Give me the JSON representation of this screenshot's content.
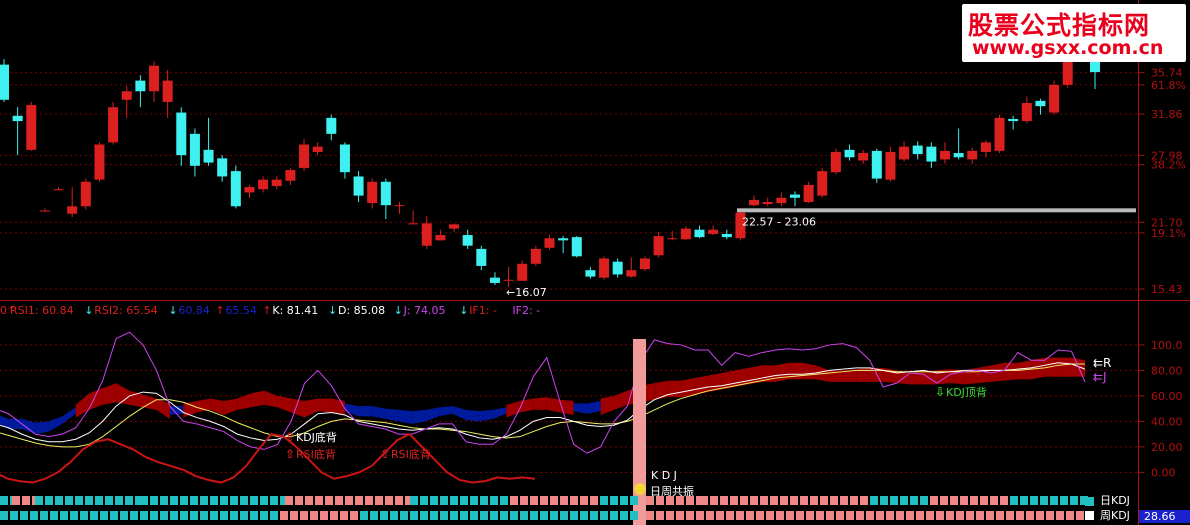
{
  "watermark": {
    "line1": "股票公式指标网",
    "line2": "www.gsxx.com.cn"
  },
  "colors": {
    "bg": "#000000",
    "up": "#dc1f1f",
    "down": "#3ff0f0",
    "grid": "#7a0000",
    "axis": "#b01010",
    "white": "#ffffff",
    "magenta": "#cc44ee",
    "yellow": "#f0f060",
    "blue_fill": "#001a9e",
    "red_fill": "#9e0000",
    "green": "#33dd33",
    "pink": "#f08888",
    "cyan_block": "#22bfc2"
  },
  "price_axis": {
    "labels": [
      {
        "text": "35.74",
        "y": 35.74
      },
      {
        "text": "61.8%",
        "y": 34.6
      },
      {
        "text": "31.86",
        "y": 31.86
      },
      {
        "text": "27.98",
        "y": 27.98
      },
      {
        "text": "38.2%",
        "y": 27.1
      },
      {
        "text": "21.70",
        "y": 21.7
      },
      {
        "text": "19.1%",
        "y": 20.7
      },
      {
        "text": "15.43",
        "y": 15.43
      }
    ],
    "ylim": [
      14.4,
      39.0
    ]
  },
  "candles": [
    [
      36.5,
      33.2,
      37,
      33
    ],
    [
      31.7,
      31.2,
      32.5,
      28
    ],
    [
      28.5,
      32.7,
      33,
      28.4
    ],
    [
      22.8,
      22.8,
      23,
      22.7
    ],
    [
      24.8,
      24.8,
      25,
      24.7
    ],
    [
      22.5,
      23.2,
      25,
      22.2
    ],
    [
      23.2,
      25.5,
      25.8,
      22.9
    ],
    [
      25.7,
      29,
      29.2,
      25.5
    ],
    [
      29.2,
      32.5,
      33,
      29
    ],
    [
      33.2,
      34,
      34.5,
      31.5
    ],
    [
      35,
      34,
      35.5,
      32.5
    ],
    [
      34,
      36.4,
      36.8,
      33
    ],
    [
      33,
      35,
      36,
      31.5
    ],
    [
      32,
      28,
      32.5,
      27
    ],
    [
      30,
      27,
      30.5,
      26
    ],
    [
      28.5,
      27.3,
      31.5,
      27
    ],
    [
      27.7,
      26,
      28,
      25.5
    ],
    [
      26.5,
      23.2,
      27,
      23
    ],
    [
      24.5,
      25,
      25.2,
      24
    ],
    [
      24.8,
      25.7,
      26,
      24.5
    ],
    [
      25.1,
      25.7,
      26,
      24.8
    ],
    [
      25.6,
      26.6,
      26.8,
      25.2
    ],
    [
      26.8,
      29,
      29.5,
      26.5
    ],
    [
      28.3,
      28.8,
      29.2,
      28
    ],
    [
      31.5,
      30,
      31.8,
      29.4
    ],
    [
      29,
      26.4,
      29.2,
      25.8
    ],
    [
      26,
      24.2,
      26.5,
      23.6
    ],
    [
      23.5,
      25.5,
      25.8,
      23
    ],
    [
      25.5,
      23.3,
      25.8,
      22
    ],
    [
      23.3,
      23.3,
      23.6,
      22.5
    ],
    [
      21.6,
      21.6,
      22.8,
      21.5
    ],
    [
      19.5,
      21.6,
      22.3,
      19.2
    ],
    [
      20,
      20.5,
      21,
      20
    ],
    [
      21.1,
      21.5,
      21.6,
      20.8
    ],
    [
      20.5,
      19.5,
      21,
      19.2
    ],
    [
      19.2,
      17.6,
      19.5,
      17.2
    ],
    [
      16.5,
      16,
      17,
      15.8
    ],
    [
      16.3,
      16.3,
      17.5,
      15.6
    ],
    [
      16.2,
      17.8,
      18.1,
      16.2
    ],
    [
      17.8,
      19.2,
      19.5,
      17.6
    ],
    [
      19.3,
      20.2,
      20.5,
      19.1
    ],
    [
      20.2,
      20,
      20.4,
      18.8
    ],
    [
      20.3,
      18.5,
      20.4,
      18.4
    ],
    [
      17.2,
      16.6,
      17.5,
      16.4
    ],
    [
      16.5,
      18.3,
      18.5,
      16.3
    ],
    [
      18,
      16.8,
      18.3,
      16.5
    ],
    [
      16.6,
      17.2,
      18.4,
      16.5
    ],
    [
      17.3,
      18.3,
      18.5,
      17.1
    ],
    [
      18.6,
      20.4,
      20.8,
      18.4
    ],
    [
      20.2,
      20.2,
      20.9,
      20
    ],
    [
      20.1,
      21.1,
      21.3,
      20
    ],
    [
      21,
      20.3,
      21.4,
      20.2
    ],
    [
      20.6,
      21,
      21.4,
      20.5
    ],
    [
      20.6,
      20.3,
      21,
      20.1
    ],
    [
      20.2,
      22.6,
      22.8,
      20
    ],
    [
      23.3,
      23.8,
      24.2,
      23.2
    ],
    [
      23.4,
      23.6,
      24,
      23.2
    ],
    [
      23.5,
      24,
      24.5,
      23.2
    ],
    [
      24.3,
      24,
      24.6,
      23.2
    ],
    [
      23.6,
      25.2,
      25.5,
      23.5
    ],
    [
      24.2,
      26.5,
      26.8,
      24
    ],
    [
      26.4,
      28.3,
      28.6,
      26.2
    ],
    [
      28.5,
      27.8,
      29,
      27.5
    ],
    [
      27.5,
      28.2,
      28.5,
      27.2
    ],
    [
      28.4,
      25.8,
      28.6,
      25.4
    ],
    [
      25.7,
      28.3,
      28.8,
      25.5
    ],
    [
      27.6,
      28.8,
      29.3,
      27.4
    ],
    [
      28.9,
      28.1,
      29.3,
      27.6
    ],
    [
      28.8,
      27.4,
      29.2,
      26.8
    ],
    [
      27.6,
      28.4,
      29.2,
      27.2
    ],
    [
      28.2,
      27.8,
      30.5,
      27.6
    ],
    [
      27.6,
      28.4,
      28.7,
      27.2
    ],
    [
      28.3,
      29.2,
      29.4,
      27.8
    ],
    [
      28.4,
      31.5,
      31.8,
      28.2
    ],
    [
      31.4,
      31.2,
      31.7,
      30.4
    ],
    [
      31.2,
      32.9,
      33.5,
      31
    ],
    [
      33.1,
      32.6,
      33.3,
      31.8
    ],
    [
      32,
      34.6,
      35,
      31.8
    ],
    [
      34.6,
      38.4,
      38.8,
      34.3
    ],
    [
      38.3,
      37.3,
      38.8,
      36.8
    ],
    [
      37.5,
      35.8,
      38.8,
      34.2
    ]
  ],
  "price_annotations": {
    "low_label": "16.07",
    "range_label": "22.57 - 23.06",
    "range_level": 22.82
  },
  "indicator_header": [
    {
      "text": "0↑",
      "color": "#dc1f1f"
    },
    {
      "text": "RSI1: 60.84",
      "color": "#dc1f1f"
    },
    {
      "text": "↓",
      "color": "#3ff0f0"
    },
    {
      "text": "RSI2: 65.54",
      "color": "#dc1f1f"
    },
    {
      "text": "↓",
      "color": "#3ff0f0"
    },
    {
      "text": "60.84",
      "color": "#1a22cc"
    },
    {
      "text": "↑",
      "color": "#dc1f1f"
    },
    {
      "text": "65.54",
      "color": "#1a22cc"
    },
    {
      "text": "↑",
      "color": "#dc1f1f"
    },
    {
      "text": "K: 81.41",
      "color": "#ffffff"
    },
    {
      "text": "↓",
      "color": "#3ff0f0"
    },
    {
      "text": "D: 85.08",
      "color": "#ffffff"
    },
    {
      "text": "↓",
      "color": "#3ff0f0"
    },
    {
      "text": "J: 74.05",
      "color": "#cc44ee"
    },
    {
      "text": "↓",
      "color": "#3ff0f0"
    },
    {
      "text": "IF1: -",
      "color": "#dc1f1f"
    },
    {
      "text": "IF2: -",
      "color": "#cc44ee"
    }
  ],
  "indicator_axis": {
    "labels": [
      "100.0",
      "80.00",
      "60.00",
      "40.00",
      "20.00",
      "0.00"
    ],
    "values": [
      100,
      80,
      60,
      40,
      20,
      0
    ],
    "ylim": [
      -17,
      118
    ]
  },
  "indicator": {
    "k": [
      38,
      35,
      30,
      26,
      24,
      24,
      26,
      31,
      40,
      52,
      60,
      63,
      62,
      55,
      47,
      43,
      40,
      36,
      30,
      27,
      25,
      26,
      30,
      38,
      46,
      47,
      45,
      40,
      38,
      36,
      34,
      33,
      34,
      35,
      34,
      30,
      27,
      26,
      28,
      33,
      40,
      43,
      43,
      40,
      37,
      36,
      37,
      41,
      50,
      57,
      61,
      63,
      65,
      67,
      68,
      70,
      72,
      74,
      76,
      77,
      77,
      78,
      80,
      81,
      82,
      82,
      80,
      78,
      79,
      80,
      78,
      79,
      80,
      80,
      80,
      80,
      81,
      82,
      84,
      86,
      85,
      81
    ],
    "d": [
      32,
      29,
      26,
      23,
      21,
      20,
      20,
      22,
      28,
      36,
      44,
      51,
      57,
      57,
      55,
      51,
      48,
      44,
      39,
      35,
      31,
      28,
      28,
      31,
      36,
      40,
      42,
      41,
      40,
      39,
      37,
      35,
      34,
      34,
      33,
      32,
      30,
      28,
      27,
      28,
      32,
      36,
      39,
      40,
      39,
      38,
      38,
      40,
      44,
      49,
      54,
      58,
      61,
      64,
      66,
      68,
      70,
      72,
      74,
      75,
      76,
      77,
      78,
      79,
      80,
      80,
      80,
      79,
      79,
      79,
      79,
      79,
      79,
      79,
      80,
      80,
      80,
      81,
      82,
      84,
      85,
      85
    ],
    "j": [
      50,
      46,
      38,
      30,
      28,
      30,
      35,
      50,
      72,
      105,
      110,
      100,
      80,
      52,
      40,
      38,
      35,
      32,
      25,
      20,
      18,
      22,
      40,
      70,
      80,
      68,
      50,
      38,
      36,
      34,
      30,
      30,
      34,
      38,
      38,
      24,
      22,
      22,
      30,
      50,
      75,
      90,
      55,
      22,
      15,
      20,
      40,
      52,
      88,
      104,
      101,
      100,
      96,
      96,
      84,
      94,
      91,
      94,
      96,
      97,
      96,
      97,
      100,
      101,
      98,
      88,
      67,
      70,
      78,
      77,
      70,
      77,
      79,
      80,
      78,
      80,
      94,
      88,
      88,
      96,
      95,
      71
    ],
    "rsi1": [
      40,
      34,
      34,
      30,
      32,
      38,
      47,
      56,
      60,
      64,
      58,
      55,
      52,
      45,
      46,
      50,
      52,
      48,
      52,
      56,
      58,
      54,
      50,
      46,
      51,
      50,
      48,
      44,
      44,
      42,
      40,
      38,
      40,
      44,
      46,
      41,
      40,
      42,
      46,
      50,
      52,
      53,
      50,
      48,
      46,
      48,
      52,
      58,
      62,
      64,
      66,
      66,
      68,
      70,
      72,
      74,
      76,
      78,
      78,
      80,
      80,
      78,
      74,
      74,
      75,
      76,
      76,
      74,
      72,
      73,
      74,
      75,
      74,
      76,
      78,
      80,
      80,
      82,
      84,
      84,
      84,
      82
    ],
    "rsi2": [
      42,
      38,
      38,
      35,
      36,
      40,
      46,
      52,
      56,
      58,
      56,
      54,
      52,
      48,
      48,
      50,
      52,
      50,
      52,
      54,
      56,
      54,
      52,
      50,
      52,
      52,
      50,
      48,
      48,
      46,
      45,
      44,
      45,
      47,
      48,
      45,
      44,
      45,
      47,
      50,
      52,
      52,
      51,
      50,
      50,
      52,
      54,
      56,
      58,
      60,
      62,
      62,
      64,
      66,
      68,
      70,
      72,
      74,
      74,
      76,
      76,
      76,
      74,
      74,
      74,
      74,
      74,
      73,
      72,
      72,
      72,
      73,
      72,
      73,
      74,
      75,
      76,
      76,
      78,
      78,
      78,
      78
    ],
    "red_line": [
      0,
      -5,
      -7,
      -8,
      -5,
      0,
      8,
      18,
      24,
      26,
      22,
      18,
      12,
      8,
      5,
      2,
      -3,
      -6,
      -8,
      -4,
      5,
      18,
      30,
      28,
      20,
      10,
      0,
      -5,
      -3,
      0,
      5,
      15,
      25,
      30,
      20,
      10,
      0,
      -6,
      -8,
      -7,
      -4,
      -5,
      -4,
      -5
    ],
    "signals": {
      "kdj_bottom": "KDJ底背",
      "rsi_bottom": "RSI底背",
      "rsi_bottom2": "RSI底背",
      "kdj_top": "KDJ顶背",
      "kdj_label": "K D J",
      "resonance": "日周共振",
      "r_label": "R",
      "j_label": "J"
    },
    "daily_kdj_label": "日KDJ",
    "weekly_kdj_label": "周KDJ",
    "weekly_value": "28.66"
  }
}
